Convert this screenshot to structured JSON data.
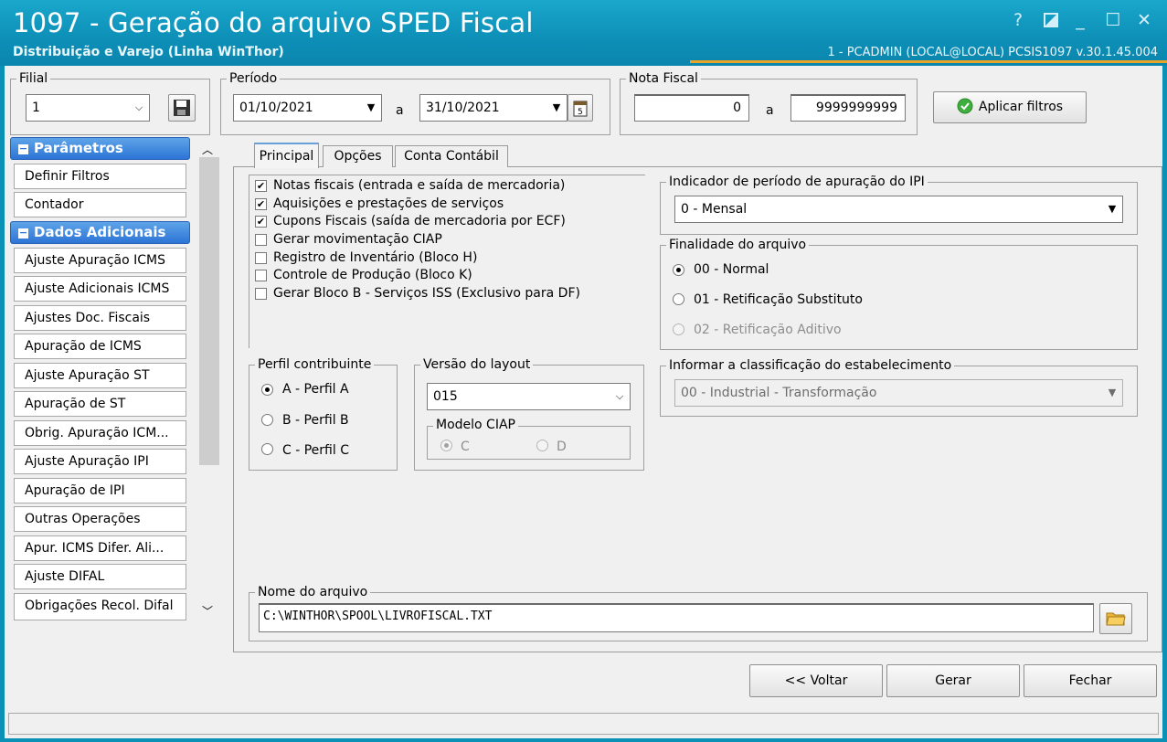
{
  "window": {
    "title": "1097 - Geração do arquivo SPED Fiscal",
    "subtitle": "Distribuição e Varejo (Linha WinThor)",
    "user_info": "1 - PCADMIN (LOCAL@LOCAL)   PCSIS1097  v.30.1.45.004",
    "controls": [
      "help-icon",
      "restore-icon",
      "minimize-icon",
      "maximize-icon",
      "close-icon"
    ],
    "accent_color": "#0d8fb7"
  },
  "filters": {
    "filial_label": "Filial",
    "filial_value": "1",
    "periodo_label": "Período",
    "date_from": "01/10/2021",
    "sep": "a",
    "date_to": "31/10/2021",
    "nota_label": "Nota Fiscal",
    "nota_from": "0",
    "nota_to": "9999999999",
    "apply_label": "Aplicar filtros"
  },
  "sidebar": {
    "section1": "Parâmetros",
    "section1_items": [
      "Definir Filtros",
      "Contador"
    ],
    "section2": "Dados Adicionais",
    "section2_items": [
      "Ajuste Apuração ICMS",
      "Ajuste Adicionais ICMS",
      "Ajustes Doc. Fiscais",
      "Apuração de ICMS",
      "Ajuste Apuração ST",
      "Apuração de ST",
      "Obrig. Apuração ICM...",
      "Ajuste Apuração IPI",
      "Apuração de IPI",
      "Outras Operações",
      "Apur. ICMS Difer. Ali...",
      "Ajuste DIFAL",
      "Obrigações Recol. Difal"
    ]
  },
  "tabs": [
    "Principal",
    "Opções",
    "Conta Contábil"
  ],
  "checks": [
    {
      "label": "Notas fiscais (entrada e saída de mercadoria)",
      "checked": true
    },
    {
      "label": "Aquisições e prestações de serviços",
      "checked": true
    },
    {
      "label": "Cupons Fiscais (saída de mercadoria por ECF)",
      "checked": true
    },
    {
      "label": "Gerar movimentação CIAP",
      "checked": false
    },
    {
      "label": "Registro de Inventário (Bloco H)",
      "checked": false
    },
    {
      "label": "Controle de Produção (Bloco K)",
      "checked": false
    },
    {
      "label": "Gerar Bloco B - Serviços ISS (Exclusivo para DF)",
      "checked": false
    }
  ],
  "ipi": {
    "label": "Indicador de período de apuração do IPI",
    "value": "0 - Mensal"
  },
  "finalidade": {
    "label": "Finalidade do arquivo",
    "options": [
      "00 - Normal",
      "01 - Retificação Substituto",
      "02 - Retificação Aditivo"
    ],
    "selected": 0
  },
  "perfil": {
    "label": "Perfil contribuinte",
    "options": [
      "A - Perfil A",
      "B - Perfil B",
      "C - Perfil C"
    ],
    "selected": 0
  },
  "versao": {
    "label": "Versão do layout",
    "value": "015",
    "ciap_label": "Modelo CIAP",
    "ciap_options": [
      "C",
      "D"
    ]
  },
  "classificacao": {
    "label": "Informar a classificação do estabelecimento",
    "value": "00 - Industrial - Transformação"
  },
  "arquivo": {
    "label": "Nome do arquivo",
    "value": "C:\\WINTHOR\\SPOOL\\LIVROFISCAL.TXT"
  },
  "footer": {
    "back": "<< Voltar",
    "generate": "Gerar",
    "close": "Fechar"
  }
}
